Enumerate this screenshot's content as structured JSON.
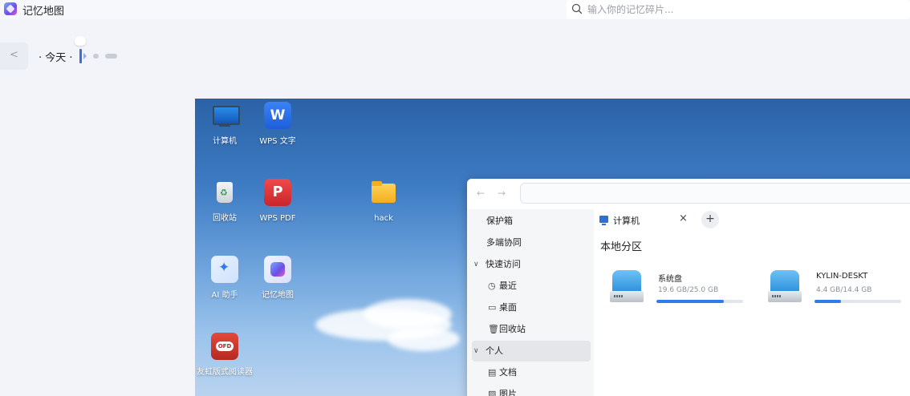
{
  "app": {
    "title": "记忆地图",
    "search_placeholder": "输入你的记忆碎片..."
  },
  "timeline": {
    "back_icon": "chevron-left-icon",
    "label": "· 今天 ·"
  },
  "desktop": {
    "icons": [
      {
        "label": "计算机",
        "icon": "computer-icon"
      },
      {
        "label": "WPS 文字",
        "icon": "wps-writer-icon",
        "glyph": "W"
      },
      {
        "label": "回收站",
        "icon": "trash-icon"
      },
      {
        "label": "WPS PDF",
        "icon": "wps-pdf-icon",
        "glyph": "P"
      },
      {
        "label": "hack",
        "icon": "folder-icon"
      },
      {
        "label": "AI 助手",
        "icon": "ai-assistant-icon"
      },
      {
        "label": "记忆地图",
        "icon": "memory-map-icon"
      },
      {
        "label": "友虹版式阅读器",
        "icon": "ofd-reader-icon"
      }
    ]
  },
  "file_manager": {
    "nav": {
      "back": "←",
      "forward": "→"
    },
    "sidebar": [
      {
        "label": "保护箱"
      },
      {
        "label": "多端协同"
      },
      {
        "label": "快速访问",
        "chevron": "∨"
      },
      {
        "label": "最近",
        "icon": "◷"
      },
      {
        "label": "桌面",
        "icon": "▭"
      },
      {
        "label": "回收站",
        "icon": "🗑"
      },
      {
        "label": "个人",
        "chevron": "∨"
      },
      {
        "label": "文档",
        "icon": "▤"
      },
      {
        "label": "图片",
        "icon": "▨"
      }
    ],
    "tab": {
      "label": "计算机",
      "close": "×",
      "add": "+"
    },
    "section_title": "本地分区",
    "disks": [
      {
        "name": "系统盘",
        "size": "19.6 GB/25.0 GB",
        "usage": 0.78
      },
      {
        "name": "KYLIN-DESKT",
        "size": "4.4 GB/14.4 GB",
        "usage": 0.31
      }
    ]
  }
}
